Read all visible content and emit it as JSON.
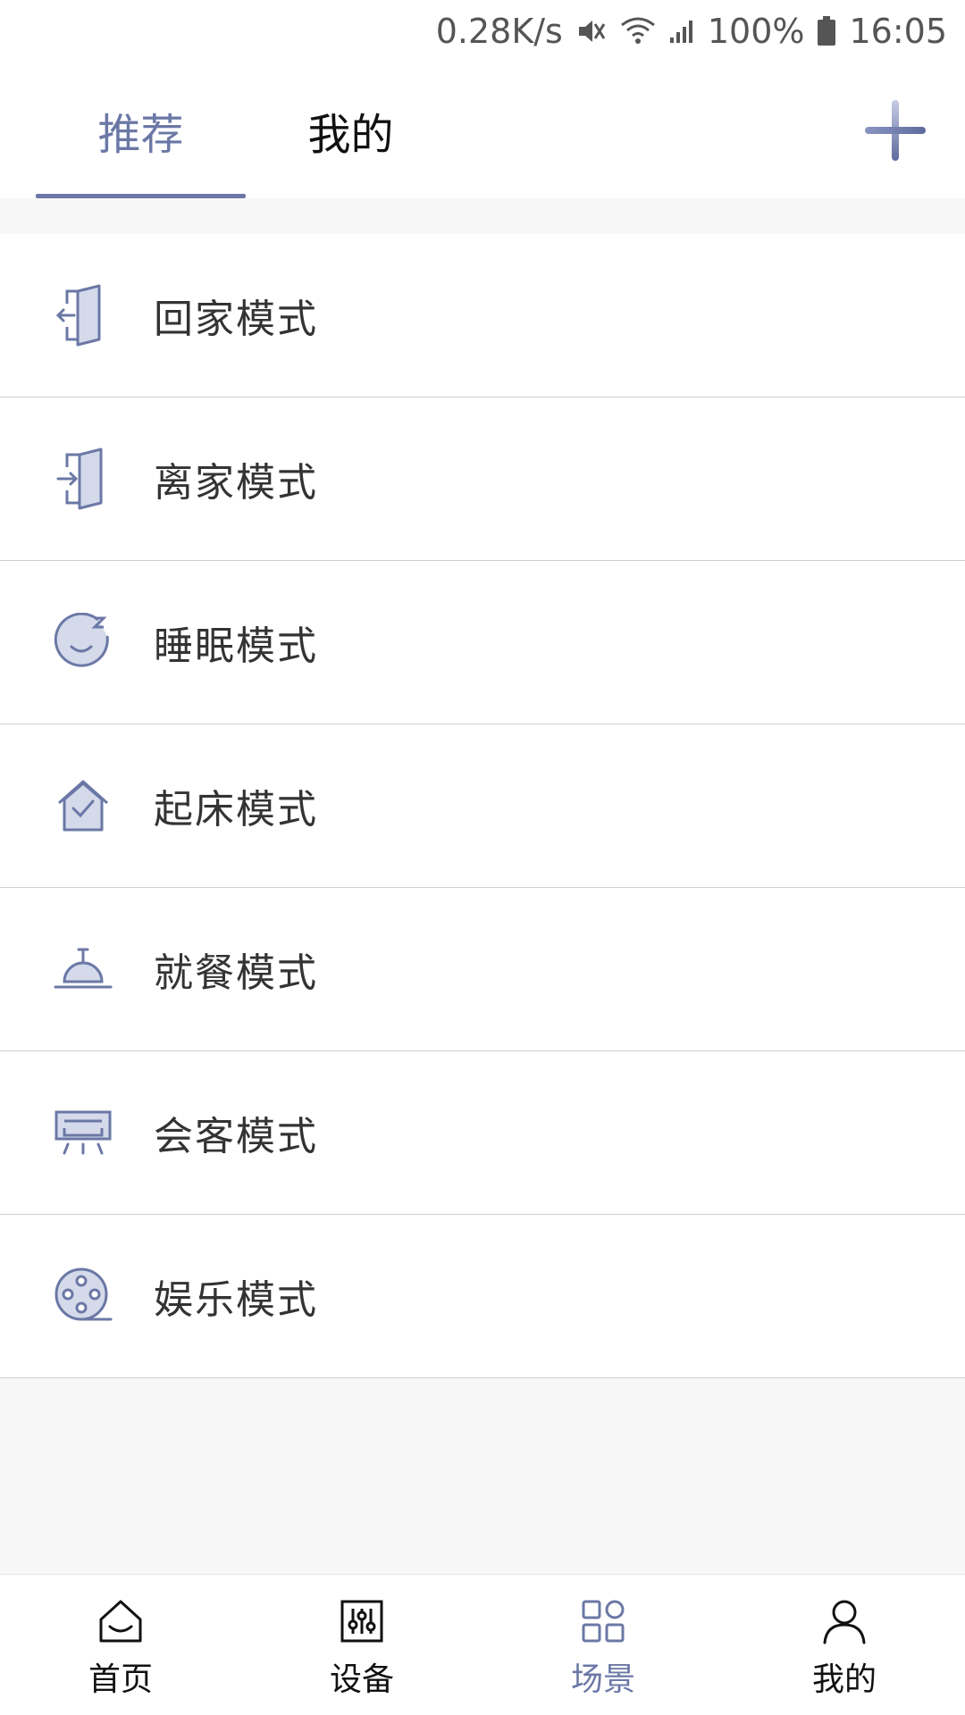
{
  "status_bar": {
    "net_speed": "0.28K/s",
    "battery": "100%",
    "time": "16:05"
  },
  "header": {
    "tabs": [
      {
        "label": "推荐",
        "active": true
      },
      {
        "label": "我的",
        "active": false
      }
    ]
  },
  "scenes": [
    {
      "label": "回家模式",
      "icon": "door-enter-icon"
    },
    {
      "label": "离家模式",
      "icon": "door-exit-icon"
    },
    {
      "label": "睡眠模式",
      "icon": "sleep-face-icon"
    },
    {
      "label": "起床模式",
      "icon": "house-check-icon"
    },
    {
      "label": "就餐模式",
      "icon": "dining-bell-icon"
    },
    {
      "label": "会客模式",
      "icon": "air-conditioner-icon"
    },
    {
      "label": "娱乐模式",
      "icon": "film-reel-icon"
    }
  ],
  "bottom_nav": [
    {
      "label": "首页",
      "icon": "home-icon",
      "active": false
    },
    {
      "label": "设备",
      "icon": "device-sliders-icon",
      "active": false
    },
    {
      "label": "场景",
      "icon": "scene-grid-icon",
      "active": true
    },
    {
      "label": "我的",
      "icon": "person-icon",
      "active": false
    }
  ],
  "colors": {
    "accent": "#6b78a6",
    "icon_fill": "#d4daea"
  }
}
